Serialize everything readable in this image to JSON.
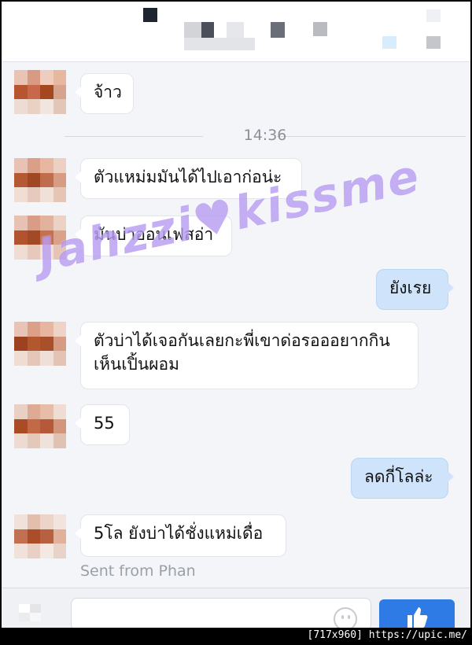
{
  "time_separator": "14:36",
  "messages": [
    {
      "direction": "in",
      "text": "จ้าว"
    },
    {
      "direction": "in",
      "text": "ตัวแหม่มมันได้ไปเอาก่อน่ะ"
    },
    {
      "direction": "in",
      "text": "มันบ่าออนเฟสอ่า"
    },
    {
      "direction": "out",
      "text": "ยังเรย"
    },
    {
      "direction": "in",
      "line1": "ตัวบ่าได้เจอกันเลยกะพี่เขาด่อรอออยากกิน",
      "line2": "เห็นเปิ้นผอม"
    },
    {
      "direction": "in",
      "text": "55"
    },
    {
      "direction": "out",
      "text": "ลดกี่โลล่ะ"
    },
    {
      "direction": "in",
      "text": "5โล ยังบ่าได้ชั่งแหม่เดื่อ"
    }
  ],
  "sent_from": "Sent from Phan",
  "watermark": "Jahzzi♥kissme",
  "footer": "[717x960] https://upic.me/",
  "colors": {
    "incoming_bubble": "#ffffff",
    "outgoing_bubble": "#cfe4fb",
    "send_button": "#2f7be6",
    "chat_background": "#f4f5f8"
  },
  "icons": [
    "like-thumb-icon",
    "emoji-icon"
  ]
}
